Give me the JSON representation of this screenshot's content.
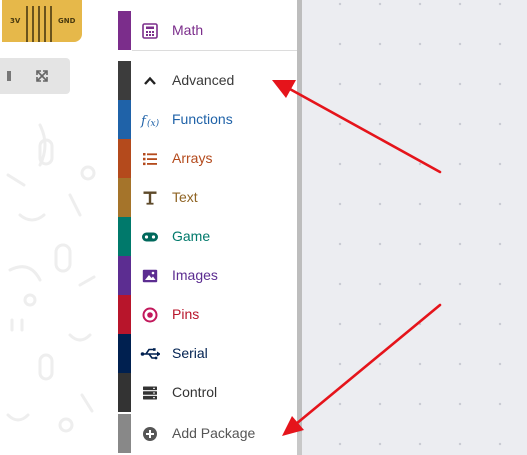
{
  "simulator": {
    "pin_labels": [
      "3V",
      "GND"
    ]
  },
  "toolbox": {
    "categories": [
      {
        "label": "Math",
        "icon": "calculator-icon",
        "color": "#7b2d8b"
      },
      {
        "label": "Advanced",
        "icon": "chevron-up-icon",
        "color": "#3c3c3c"
      },
      {
        "label": "Functions",
        "icon": "function-icon",
        "color": "#1f62a8"
      },
      {
        "label": "Arrays",
        "icon": "list-icon",
        "color": "#b44a1c"
      },
      {
        "label": "Text",
        "icon": "text-icon",
        "color": "#a5742a"
      },
      {
        "label": "Game",
        "icon": "gamepad-icon",
        "color": "#00796b"
      },
      {
        "label": "Images",
        "icon": "image-icon",
        "color": "#5c2d91"
      },
      {
        "label": "Pins",
        "icon": "target-icon",
        "color": "#b8152b"
      },
      {
        "label": "Serial",
        "icon": "usb-icon",
        "color": "#002050"
      },
      {
        "label": "Control",
        "icon": "server-icon",
        "color": "#333333"
      },
      {
        "label": "Add Package",
        "icon": "plus-circle-icon",
        "color": "#888888"
      }
    ]
  },
  "colors": {
    "arrow": "#e5141b",
    "workspace": "#ecedf1"
  }
}
